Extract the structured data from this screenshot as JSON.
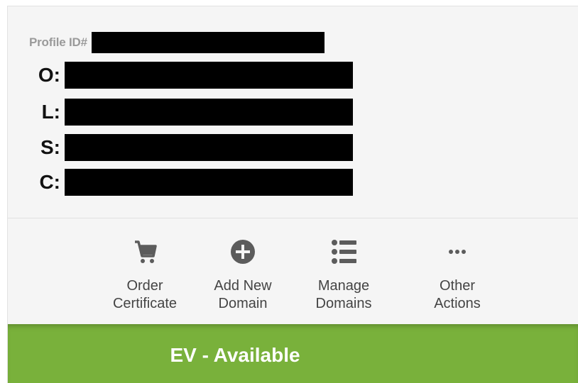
{
  "profile": {
    "id_label": "Profile ID#",
    "fields": [
      {
        "label": "O:"
      },
      {
        "label": "L:"
      },
      {
        "label": "S:"
      },
      {
        "label": "C:"
      }
    ]
  },
  "actions": [
    {
      "label_line1": "Order",
      "label_line2": "Certificate",
      "icon": "cart-icon"
    },
    {
      "label_line1": "Add New",
      "label_line2": "Domain",
      "icon": "plus-circle-icon"
    },
    {
      "label_line1": "Manage",
      "label_line2": "Domains",
      "icon": "list-icon"
    },
    {
      "label_line1": "Other",
      "label_line2": "Actions",
      "icon": "more-dots-icon"
    }
  ],
  "status": {
    "text": "EV - Available",
    "color": "#79b13b"
  }
}
